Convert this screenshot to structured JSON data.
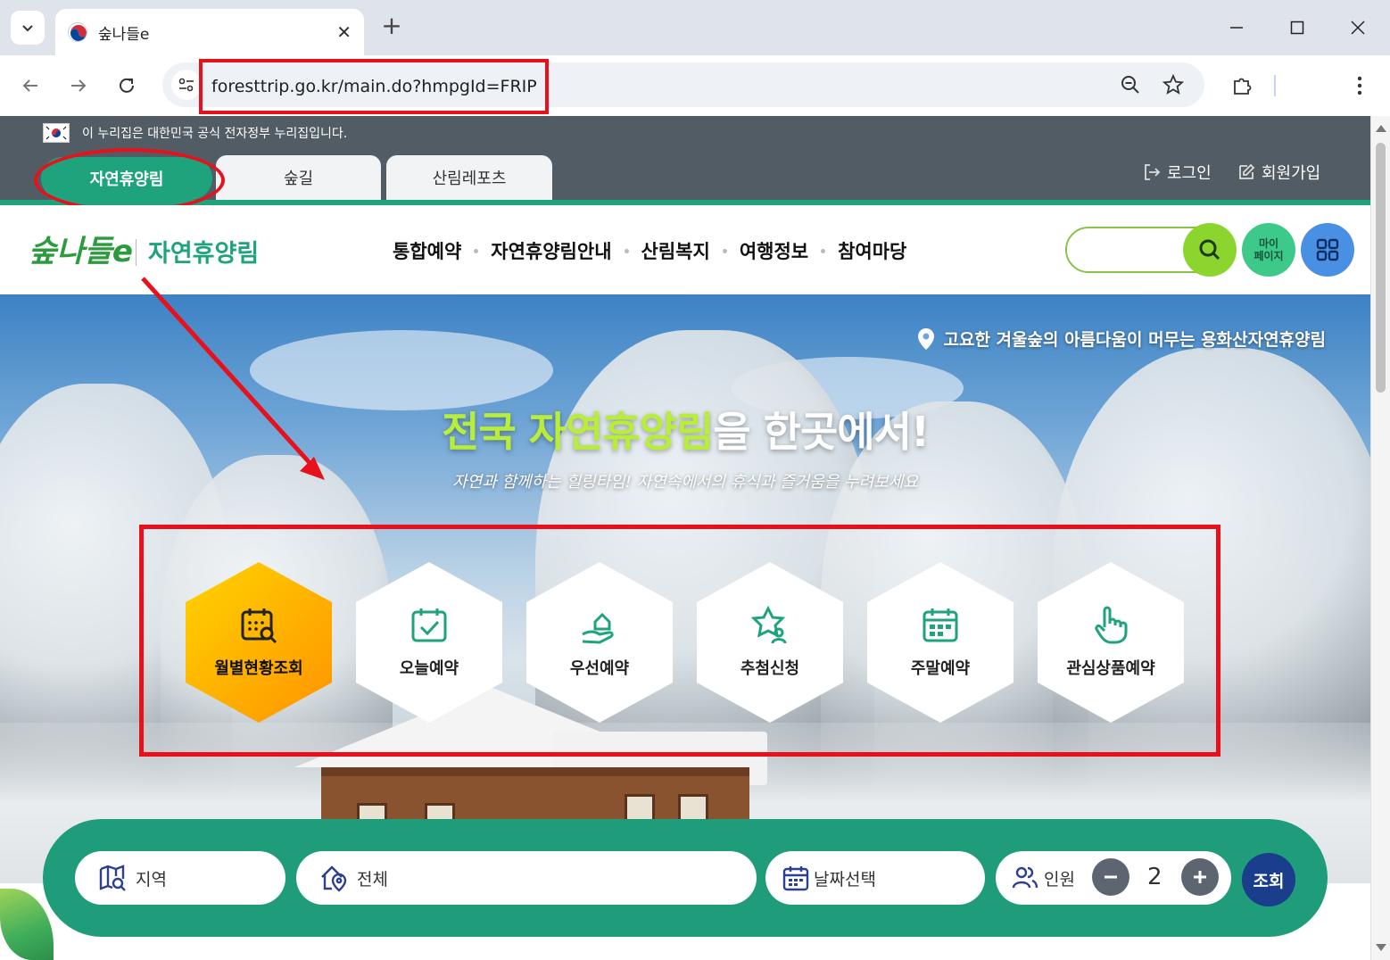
{
  "browser": {
    "tab_title": "숲나들e",
    "url": "foresttrip.go.kr/main.do?hmpgId=FRIP"
  },
  "gov_banner": {
    "text": "이 누리집은 대한민국 공식 전자정부 누리집입니다."
  },
  "site_tabs": [
    {
      "label": "자연휴양림"
    },
    {
      "label": "숲길"
    },
    {
      "label": "산림레포츠"
    }
  ],
  "top_links": {
    "login": "로그인",
    "signup": "회원가입"
  },
  "header": {
    "logo": "숲나들e",
    "logo_sub": "자연휴양림",
    "menu": [
      "통합예약",
      "자연휴양림안내",
      "산림복지",
      "여행정보",
      "참여마당"
    ],
    "mypage_line1": "마이",
    "mypage_line2": "페이지"
  },
  "hero": {
    "location": "고요한 겨울숲의 아름다움이 머무는 용화산자연휴양림",
    "title_highlight": "전국 자연휴양림",
    "title_rest": "을 한곳에서!",
    "subtitle": "자연과 함께하는 힐링타임! 자연속에서의 휴식과 즐거움을 누려보세요"
  },
  "quick_menu": [
    {
      "label": "월별현황조회",
      "icon": "calendar-search-icon"
    },
    {
      "label": "오늘예약",
      "icon": "calendar-check-icon"
    },
    {
      "label": "우선예약",
      "icon": "hand-house-icon"
    },
    {
      "label": "추첨신청",
      "icon": "star-person-icon"
    },
    {
      "label": "주말예약",
      "icon": "calendar-grid-icon"
    },
    {
      "label": "관심상품예약",
      "icon": "pointer-hand-icon"
    }
  ],
  "search_bar": {
    "region": "지역",
    "facility": "전체",
    "date": "날짜선택",
    "people_label": "인원",
    "people_count": "2",
    "query": "조회"
  },
  "colors": {
    "brand_green": "#1fa37c",
    "annotation_red": "#e8101b",
    "featured_yellow": "#ffb000",
    "query_blue": "#1a3e8b"
  }
}
